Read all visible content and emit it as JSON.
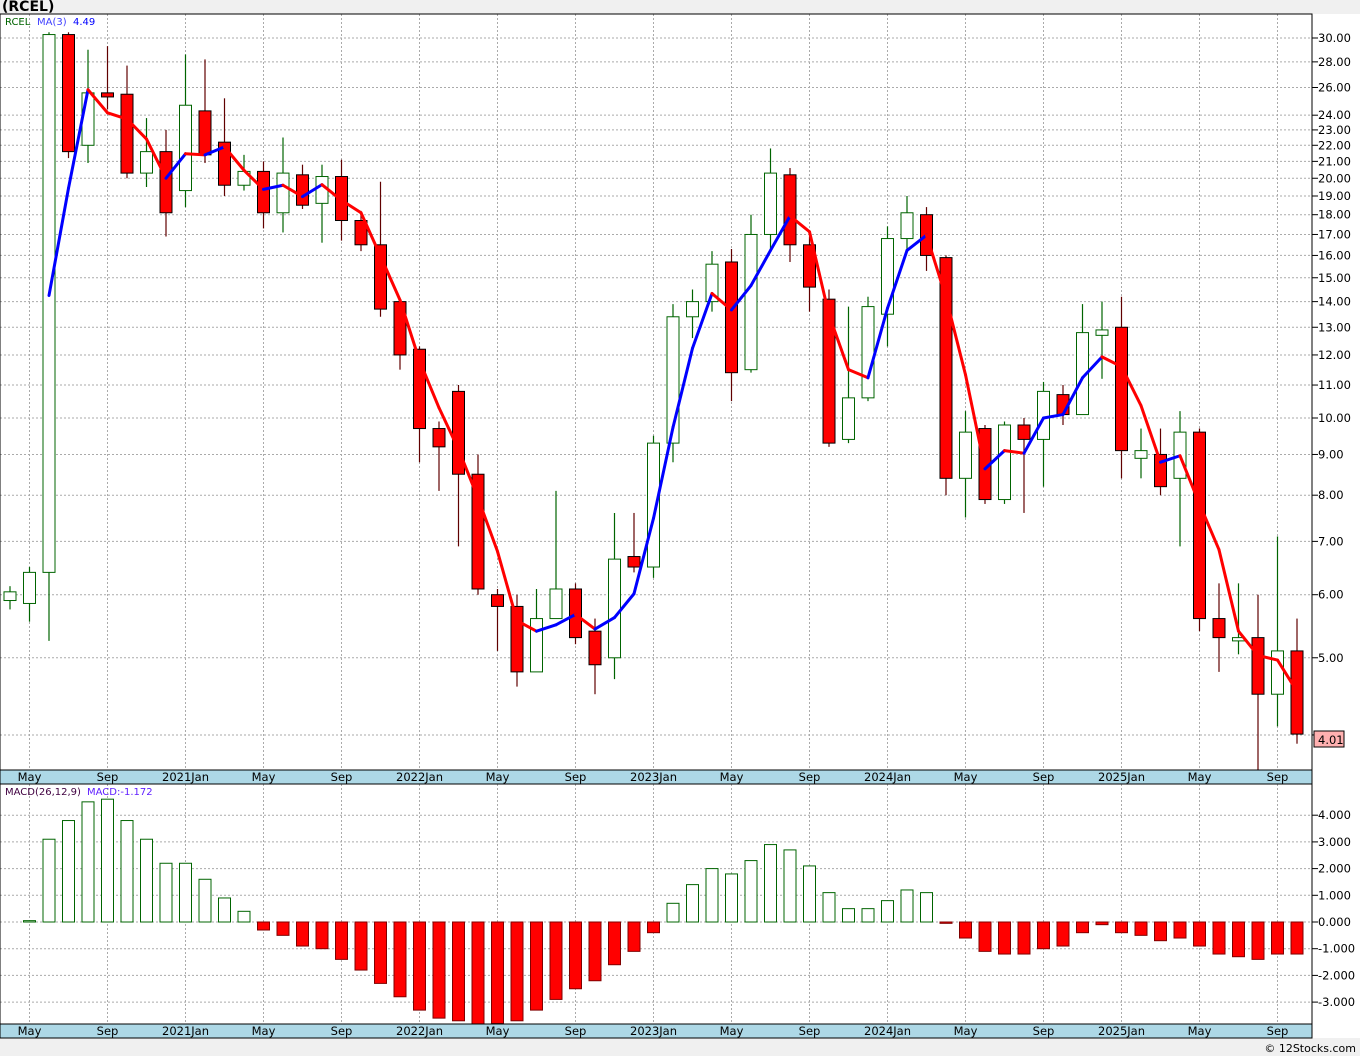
{
  "title": "(RCEL)",
  "footer": "© 12Stocks.com",
  "legend": {
    "symbol": "RCEL",
    "ma_label": "MA(3)",
    "ma_value": "4.49",
    "macd_label": "MACD(26,12,9)",
    "macd_value": "MACD:-1.172"
  },
  "last_price_label": "4.01",
  "colors": {
    "up": "#006400",
    "down": "#ff0000",
    "ma_up": "#0000ff",
    "ma_down": "#ff0000",
    "axis_band": "#add8e6"
  },
  "chart_data": [
    {
      "type": "candlestick",
      "scale": "log",
      "grid": true,
      "ylim": [
        3.6,
        31
      ],
      "yticks": [
        30,
        28,
        26,
        24,
        23,
        22,
        21,
        20,
        19,
        18,
        17,
        16,
        15,
        14,
        13,
        12,
        11,
        10,
        9,
        8,
        7,
        6,
        5,
        4
      ],
      "ytick_labels": [
        "30.00",
        "28.00",
        "26.00",
        "24.00",
        "23.00",
        "22.00",
        "21.00",
        "20.00",
        "19.00",
        "18.00",
        "17.00",
        "16.00",
        "15.00",
        "14.00",
        "13.00",
        "12.00",
        "11.00",
        "10.00",
        "9.00",
        "8.00",
        "7.00",
        "6.00",
        "5.00",
        "4.00"
      ],
      "xtick_labels": [
        {
          "label": "May",
          "index": 1
        },
        {
          "label": "Sep",
          "index": 5
        },
        {
          "label": "2021Jan",
          "index": 9
        },
        {
          "label": "May",
          "index": 13
        },
        {
          "label": "Sep",
          "index": 17
        },
        {
          "label": "2022Jan",
          "index": 21
        },
        {
          "label": "May",
          "index": 25
        },
        {
          "label": "Sep",
          "index": 29
        },
        {
          "label": "2023Jan",
          "index": 33
        },
        {
          "label": "May",
          "index": 37
        },
        {
          "label": "Sep",
          "index": 41
        },
        {
          "label": "2024Jan",
          "index": 45
        },
        {
          "label": "May",
          "index": 49
        },
        {
          "label": "Sep",
          "index": 53
        },
        {
          "label": "2025Jan",
          "index": 57
        },
        {
          "label": "May",
          "index": 61
        },
        {
          "label": "Sep",
          "index": 65
        }
      ],
      "ohlc": [
        [
          5.9,
          6.05,
          6.15,
          5.75
        ],
        [
          5.85,
          6.4,
          6.5,
          5.55
        ],
        [
          6.4,
          30.3,
          30.5,
          5.25
        ],
        [
          30.3,
          21.6,
          30.5,
          21.2
        ],
        [
          22.0,
          25.6,
          29.0,
          20.9
        ],
        [
          25.6,
          25.3,
          29.3,
          24.4
        ],
        [
          25.5,
          20.3,
          27.7,
          20.0
        ],
        [
          20.3,
          21.6,
          23.8,
          19.5
        ],
        [
          21.6,
          18.1,
          23.0,
          16.9
        ],
        [
          19.3,
          24.7,
          28.6,
          18.4
        ],
        [
          24.3,
          21.4,
          28.2,
          20.9
        ],
        [
          22.2,
          19.6,
          25.2,
          19.0
        ],
        [
          19.6,
          20.4,
          21.4,
          19.3
        ],
        [
          20.4,
          18.1,
          21.0,
          17.3
        ],
        [
          18.1,
          20.3,
          22.5,
          17.1
        ],
        [
          20.2,
          18.5,
          20.8,
          18.3
        ],
        [
          18.6,
          20.1,
          20.8,
          16.6
        ],
        [
          20.1,
          17.7,
          21.1,
          16.7
        ],
        [
          17.7,
          16.5,
          18.2,
          16.2
        ],
        [
          16.5,
          13.7,
          19.8,
          13.4
        ],
        [
          14.0,
          12.0,
          14.1,
          11.5
        ],
        [
          12.2,
          9.7,
          12.3,
          8.8
        ],
        [
          9.7,
          9.2,
          9.9,
          8.1
        ],
        [
          10.8,
          8.5,
          11.0,
          6.9
        ],
        [
          8.5,
          6.1,
          9.0,
          6.0
        ],
        [
          6.0,
          5.8,
          6.1,
          5.1
        ],
        [
          5.8,
          4.8,
          6.0,
          4.6
        ],
        [
          4.8,
          5.6,
          6.1,
          4.8
        ],
        [
          5.6,
          6.1,
          8.1,
          5.6
        ],
        [
          6.1,
          5.3,
          6.2,
          5.2
        ],
        [
          5.4,
          4.9,
          5.6,
          4.5
        ],
        [
          5.0,
          6.65,
          7.6,
          4.7
        ],
        [
          6.7,
          6.5,
          7.6,
          6.4
        ],
        [
          6.5,
          9.3,
          9.5,
          6.3
        ],
        [
          9.3,
          13.4,
          13.9,
          8.8
        ],
        [
          13.4,
          14.0,
          14.5,
          12.6
        ],
        [
          14.0,
          15.6,
          16.2,
          13.6
        ],
        [
          15.7,
          11.4,
          16.3,
          10.5
        ],
        [
          11.5,
          17.0,
          18.0,
          11.4
        ],
        [
          17.0,
          20.3,
          21.8,
          16.3
        ],
        [
          20.2,
          16.5,
          20.6,
          15.7
        ],
        [
          16.5,
          14.6,
          16.9,
          13.6
        ],
        [
          14.1,
          9.3,
          14.5,
          9.2
        ],
        [
          9.4,
          10.6,
          13.8,
          9.3
        ],
        [
          10.6,
          13.8,
          14.2,
          10.5
        ],
        [
          13.5,
          16.8,
          17.4,
          12.3
        ],
        [
          16.8,
          18.1,
          19.0,
          16.3
        ],
        [
          18.0,
          16.0,
          18.4,
          15.3
        ],
        [
          15.9,
          8.4,
          16.0,
          8.0
        ],
        [
          8.4,
          9.6,
          10.2,
          7.5
        ],
        [
          9.7,
          7.9,
          9.8,
          7.8
        ],
        [
          7.9,
          9.8,
          9.9,
          7.8
        ],
        [
          9.8,
          9.4,
          10.0,
          7.6
        ],
        [
          9.4,
          10.8,
          11.1,
          8.2
        ],
        [
          10.7,
          10.1,
          11.0,
          9.8
        ],
        [
          10.1,
          12.8,
          13.9,
          10.1
        ],
        [
          12.7,
          12.9,
          14.0,
          11.2
        ],
        [
          13.0,
          9.1,
          14.2,
          8.4
        ],
        [
          8.9,
          9.1,
          9.7,
          8.4
        ],
        [
          9.0,
          8.2,
          9.7,
          8.0
        ],
        [
          8.4,
          9.6,
          10.2,
          6.9
        ],
        [
          9.6,
          5.6,
          9.7,
          5.4
        ],
        [
          5.6,
          5.3,
          6.2,
          4.8
        ],
        [
          5.25,
          5.3,
          6.2,
          5.05
        ],
        [
          5.3,
          4.5,
          6.0,
          3.6
        ],
        [
          4.5,
          5.1,
          7.1,
          4.1
        ],
        [
          5.1,
          4.01,
          5.6,
          3.9
        ]
      ],
      "ma_period": 3
    },
    {
      "type": "bar",
      "ylim": [
        -3.9,
        4.8
      ],
      "yticks": [
        4,
        3,
        2,
        1,
        0,
        -1,
        -2,
        -3
      ],
      "ytick_labels": [
        "4.000",
        "3.000",
        "2.000",
        "1.000",
        "0.000",
        "-1.000",
        "-2.000",
        "-3.000"
      ],
      "values": [
        null,
        0.05,
        3.1,
        3.8,
        4.5,
        4.6,
        3.8,
        3.1,
        2.2,
        2.2,
        1.6,
        0.9,
        0.4,
        -0.3,
        -0.5,
        -0.9,
        -1.0,
        -1.4,
        -1.8,
        -2.3,
        -2.8,
        -3.3,
        -3.6,
        -3.7,
        -3.9,
        -3.8,
        -3.7,
        -3.3,
        -2.9,
        -2.5,
        -2.2,
        -1.6,
        -1.1,
        -0.4,
        0.7,
        1.4,
        2.0,
        1.8,
        2.3,
        2.9,
        2.7,
        2.1,
        1.1,
        0.5,
        0.5,
        0.8,
        1.2,
        1.1,
        -0.05,
        -0.6,
        -1.1,
        -1.2,
        -1.2,
        -1.0,
        -0.9,
        -0.4,
        -0.1,
        -0.4,
        -0.5,
        -0.7,
        -0.6,
        -0.9,
        -1.2,
        -1.3,
        -1.4,
        -1.2,
        -1.2
      ]
    }
  ]
}
